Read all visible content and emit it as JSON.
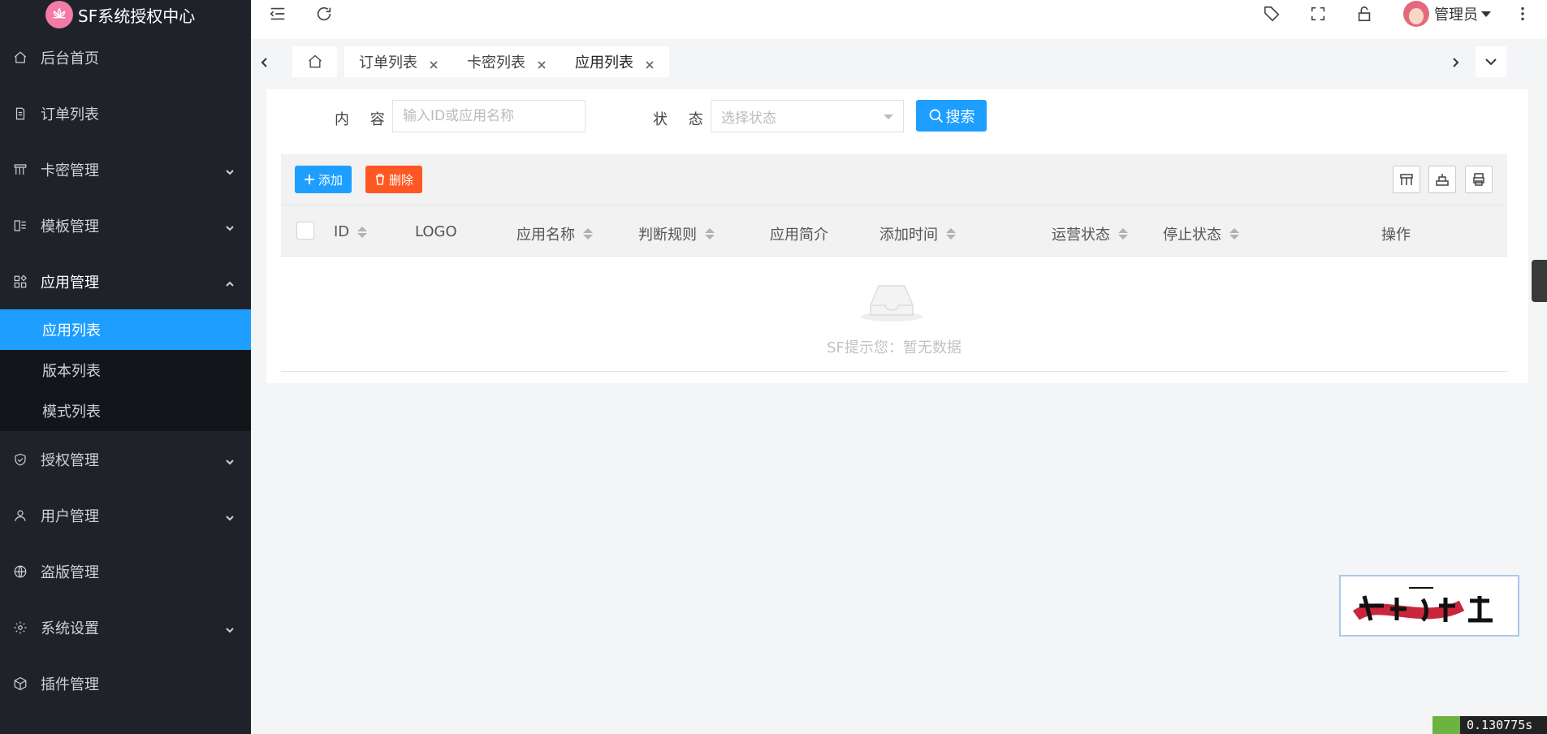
{
  "app": {
    "title": "SF系统授权中心"
  },
  "sidebar": {
    "items": [
      {
        "label": "后台首页",
        "icon": "home-icon"
      },
      {
        "label": "订单列表",
        "icon": "document-icon"
      },
      {
        "label": "卡密管理",
        "icon": "card-icon"
      },
      {
        "label": "模板管理",
        "icon": "template-icon"
      },
      {
        "label": "应用管理",
        "icon": "apps-icon"
      },
      {
        "label": "授权管理",
        "icon": "shield-icon"
      },
      {
        "label": "用户管理",
        "icon": "user-icon"
      },
      {
        "label": "盗版管理",
        "icon": "globe-icon"
      },
      {
        "label": "系统设置",
        "icon": "gear-icon"
      },
      {
        "label": "插件管理",
        "icon": "cube-icon"
      }
    ],
    "submenu": [
      {
        "label": "应用列表",
        "active": true
      },
      {
        "label": "版本列表",
        "active": false
      },
      {
        "label": "模式列表",
        "active": false
      }
    ]
  },
  "header": {
    "user": "管理员"
  },
  "tabs": [
    {
      "label": "订单列表"
    },
    {
      "label": "卡密列表"
    },
    {
      "label": "应用列表",
      "active": true
    }
  ],
  "filters": {
    "content_label": "内 容",
    "content_placeholder": "输入ID或应用名称",
    "status_label": "状 态",
    "status_placeholder": "选择状态",
    "search_label": "搜索"
  },
  "toolbar": {
    "add_label": "添加",
    "delete_label": "删除"
  },
  "table": {
    "columns": [
      "ID",
      "LOGO",
      "应用名称",
      "判断规则",
      "应用简介",
      "添加时间",
      "运营状态",
      "停止状态",
      "操作"
    ],
    "rows": [],
    "empty_text": "SF提示您：暂无数据"
  },
  "debug": {
    "timer": "0.130775s"
  },
  "colors": {
    "sidebar_bg": "#20222a",
    "accent": "#1e9fff",
    "danger": "#ff5722"
  }
}
